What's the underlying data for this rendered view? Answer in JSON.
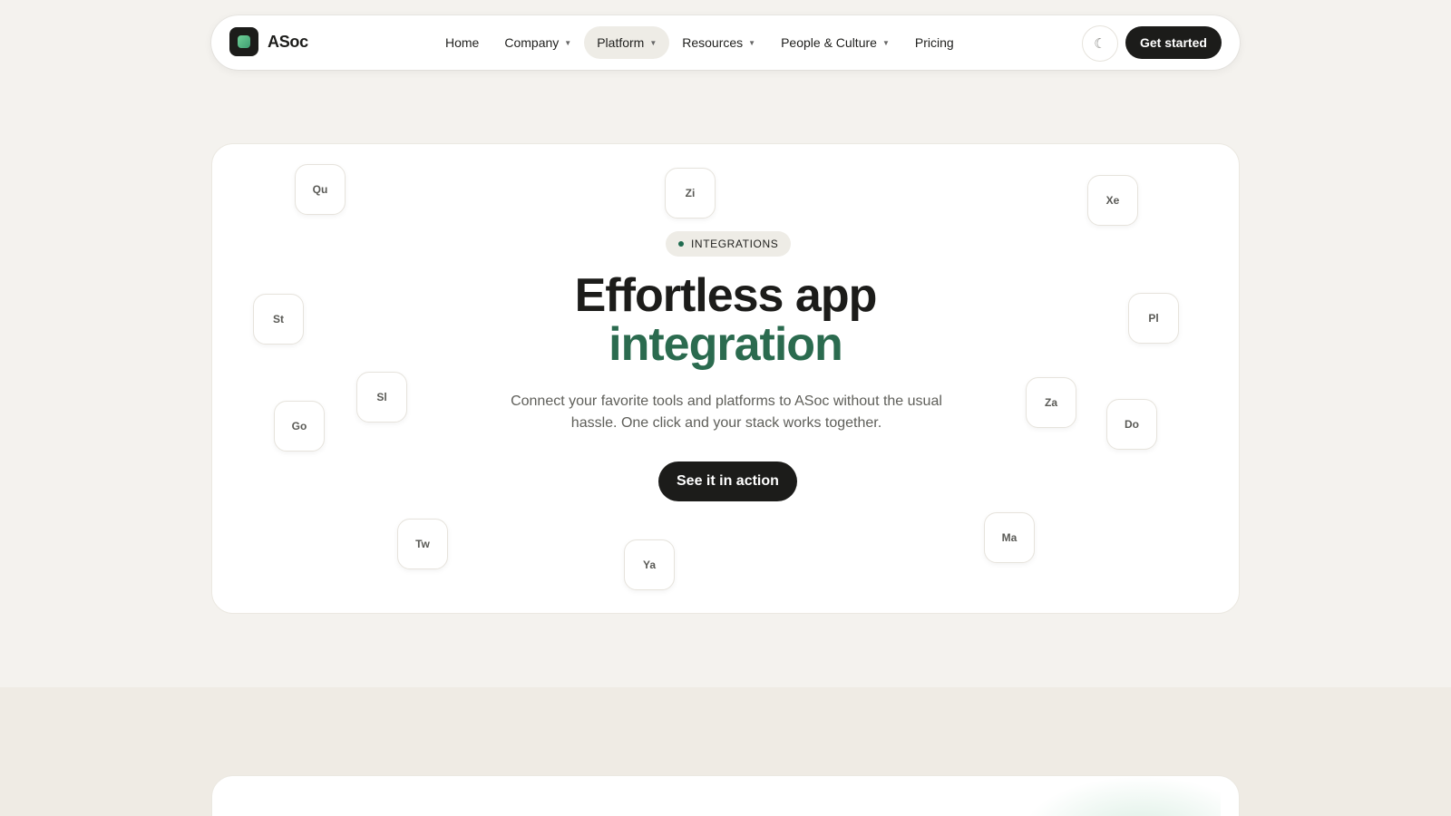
{
  "brand": {
    "name": "ASoc"
  },
  "nav": {
    "items": [
      {
        "label": "Home",
        "dropdown": false,
        "active": false
      },
      {
        "label": "Company",
        "dropdown": true,
        "active": false
      },
      {
        "label": "Platform",
        "dropdown": true,
        "active": true
      },
      {
        "label": "Resources",
        "dropdown": true,
        "active": false
      },
      {
        "label": "People & Culture",
        "dropdown": true,
        "active": false
      },
      {
        "label": "Pricing",
        "dropdown": false,
        "active": false
      }
    ],
    "theme_icon": "☾",
    "cta_label": "Get started"
  },
  "hero": {
    "badge": "INTEGRATIONS",
    "title_line1": "Effortless app",
    "title_line2": "integration",
    "subtitle": "Connect your favorite tools and platforms to ASoc without the usual hassle. One click and your stack works together.",
    "cta_label": "See it in action",
    "chips": [
      "Qu",
      "Zi",
      "Xe",
      "St",
      "Pl",
      "Sl",
      "Za",
      "Go",
      "Do",
      "Tw",
      "Ma",
      "Ya"
    ]
  },
  "colors": {
    "background": "#f4f2ee",
    "accent_green": "#2b6b4f",
    "dark": "#1c1c1a",
    "card": "#ffffff"
  }
}
